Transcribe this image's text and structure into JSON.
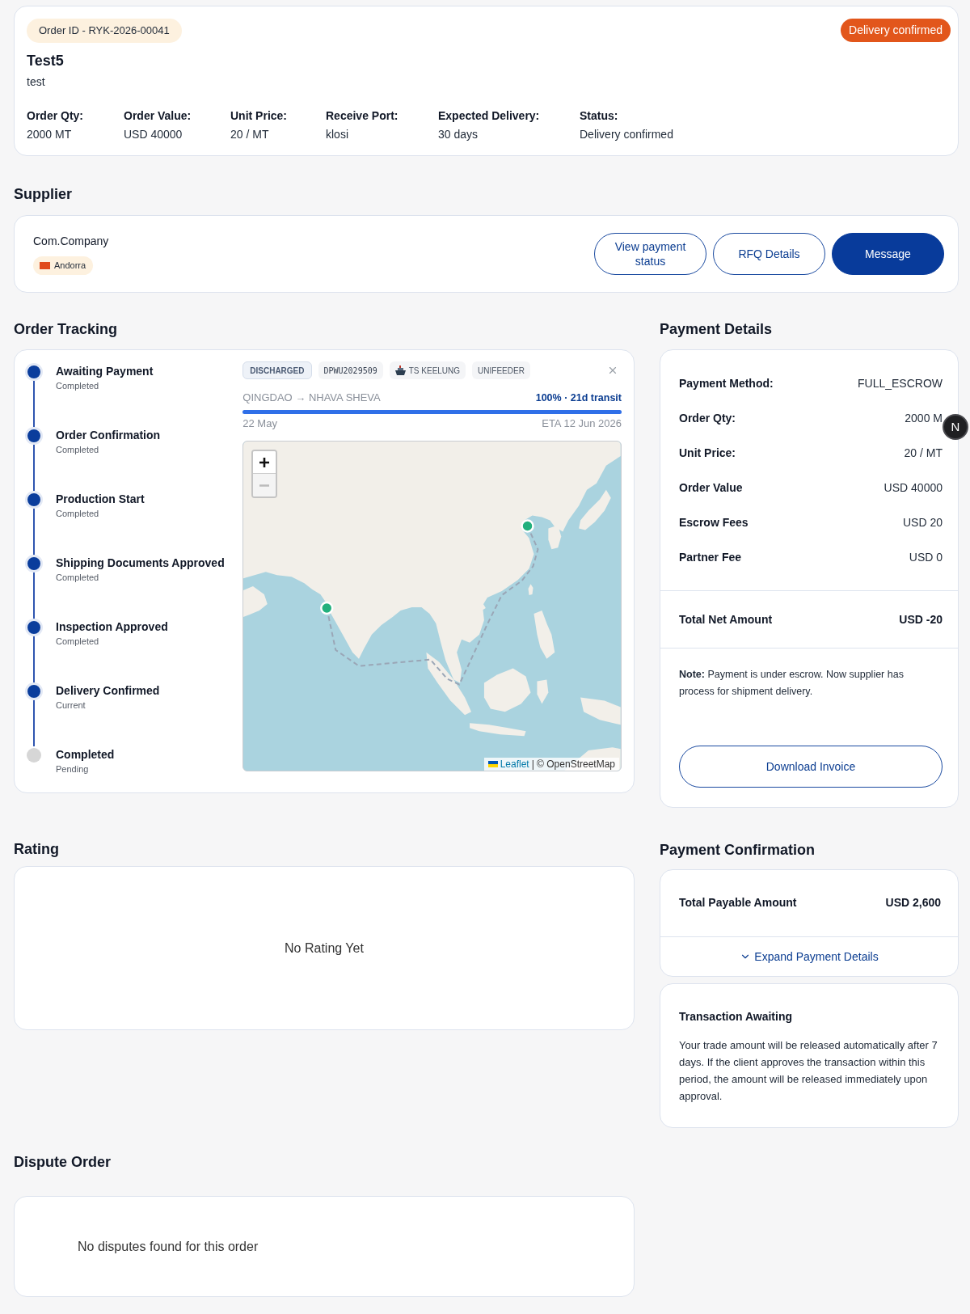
{
  "order": {
    "order_id": "Order ID - RYK-2026-00041",
    "status_badge": "Delivery confirmed",
    "title": "Test5",
    "description": "test",
    "fields": [
      {
        "label": "Order Qty:",
        "value": "2000 MT"
      },
      {
        "label": "Order Value:",
        "value": "USD 40000"
      },
      {
        "label": "Unit Price:",
        "value": "20 / MT"
      },
      {
        "label": "Receive Port:",
        "value": "klosi"
      },
      {
        "label": "Expected Delivery:",
        "value": "30 days"
      },
      {
        "label": "Status:",
        "value": "Delivery confirmed"
      }
    ]
  },
  "supplier": {
    "heading": "Supplier",
    "name": "Com.Company",
    "country": "Andorra",
    "buttons": [
      {
        "label": "View payment status",
        "kind": "outline"
      },
      {
        "label": "RFQ Details",
        "kind": "outline"
      },
      {
        "label": "Message",
        "kind": "primary"
      }
    ]
  },
  "order_tracking": {
    "heading": "Order Tracking",
    "steps": [
      {
        "title": "Awaiting Payment",
        "status": "Completed",
        "reached": true
      },
      {
        "title": "Order Confirmation",
        "status": "Completed",
        "reached": true
      },
      {
        "title": "Production Start",
        "status": "Completed",
        "reached": true
      },
      {
        "title": "Shipping Documents Approved",
        "status": "Completed",
        "reached": true
      },
      {
        "title": "Inspection Approved",
        "status": "Completed",
        "reached": true
      },
      {
        "title": "Delivery Confirmed",
        "status": "Current",
        "reached": true
      },
      {
        "title": "Completed",
        "status": "Pending",
        "reached": false
      }
    ],
    "shipment": {
      "tags": [
        {
          "kind": "status",
          "label": "DISCHARGED"
        },
        {
          "kind": "container",
          "label": "DPWU2029509"
        },
        {
          "kind": "vessel",
          "label": "TS KEELUNG"
        },
        {
          "kind": "carrier",
          "label": "UNIFEEDER"
        }
      ],
      "route": "QINGDAO → NHAVA SHEVA",
      "progress_label": "100% · 21d transit",
      "level": 1,
      "departure": "22 May",
      "eta": "ETA 12 Jun 2026",
      "map": {
        "zoom_controls": [
          {
            "kind": "zoom_in",
            "disabled": false
          },
          {
            "kind": "zoom_out",
            "disabled": true
          }
        ],
        "attribution_link": "Leaflet",
        "attribution": "| © OpenStreetMap"
      }
    }
  },
  "payment_details": {
    "heading": "Payment Details",
    "rows": [
      {
        "label": "Payment Method:",
        "value": "FULL_ESCROW"
      },
      {
        "label": "Order Qty:",
        "value": "2000 M"
      },
      {
        "label": "Unit Price:",
        "value": "20 / MT"
      },
      {
        "label": "Order Value",
        "value": "USD 40000"
      },
      {
        "label": "Escrow Fees",
        "value": "USD 20"
      },
      {
        "label": "Partner Fee",
        "value": "USD 0"
      }
    ],
    "total": {
      "label": "Total Net Amount",
      "value": "USD -20"
    },
    "note": "**Note:** Payment is under escrow. Now supplier has process for shipment delivery.",
    "button": "Download Invoice"
  },
  "rating": {
    "heading": "Rating",
    "empty": "No Rating Yet"
  },
  "payment_confirmation": {
    "heading": "Payment Confirmation",
    "total": {
      "label": "Total Payable Amount",
      "value": "USD 2,600"
    },
    "expand_link": "Expand Payment Details",
    "expanded": false,
    "transaction": {
      "title": "Transaction Awaiting",
      "text": "Your trade amount will be released automatically after 7 days. If the client approves the transaction within this period, the amount will be released immediately upon approval."
    }
  },
  "dispute": {
    "heading": "Dispute Order",
    "empty": "No disputes found for this order"
  },
  "dev_badge": {
    "label": "N"
  }
}
